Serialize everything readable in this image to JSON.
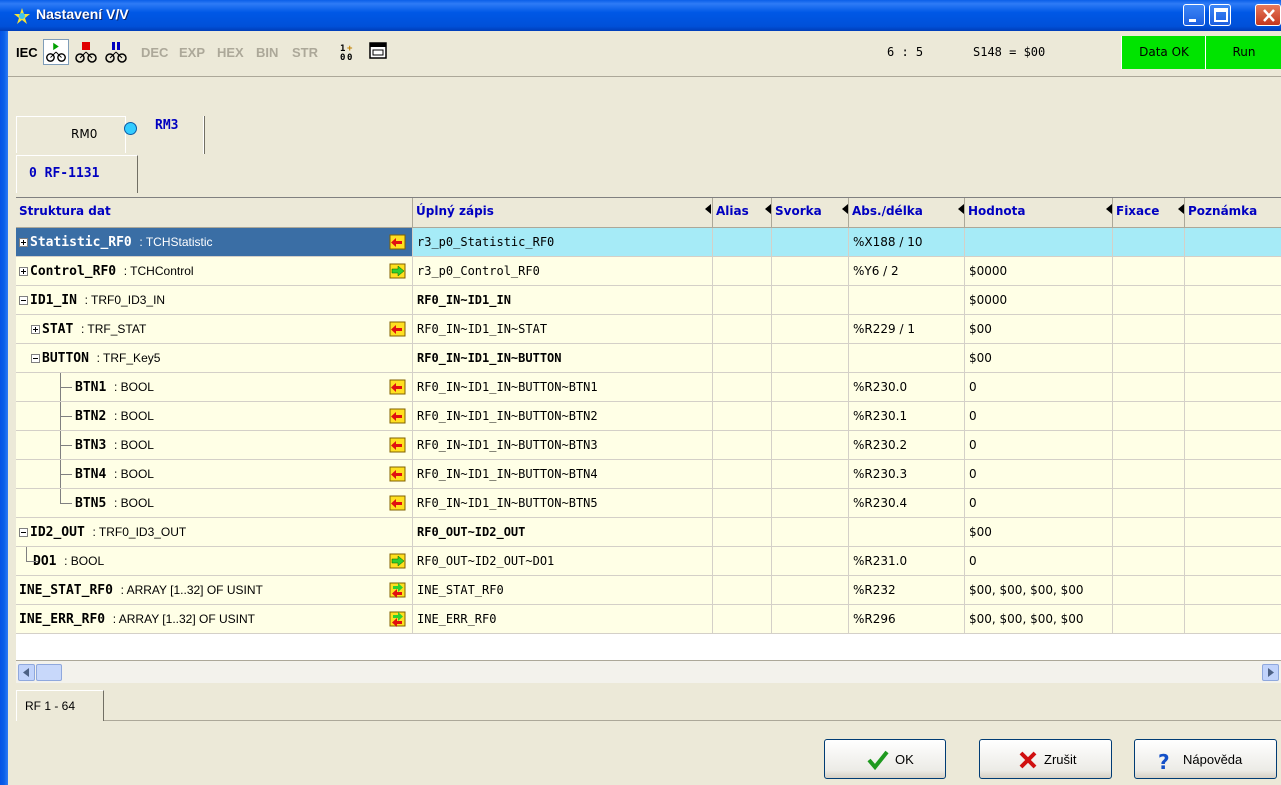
{
  "window": {
    "title": "Nastavení V/V"
  },
  "toolbar": {
    "iec": "IEC",
    "dec": "DEC",
    "exp": "EXP",
    "hex": "HEX",
    "bin": "BIN",
    "str": "STR",
    "position": "6 : 5",
    "status_value": "S148 = $00",
    "data_ok": "Data OK",
    "run": "Run"
  },
  "tabs": {
    "rm0": "RM0",
    "rm3": "RM3",
    "sub": "0 RF-1131",
    "bottom": "RF 1 - 64"
  },
  "columns": [
    "Struktura dat",
    "Úplný zápis",
    "Alias",
    "Svorka",
    "Abs./délka",
    "Hodnota",
    "Fixace",
    "Poznámka"
  ],
  "rows": [
    {
      "name": "Statistic_RF0",
      "type": ": TCHStatistic",
      "full": "r3_p0_Statistic_RF0",
      "abs": "%X188 / 10",
      "value": ""
    },
    {
      "name": "Control_RF0",
      "type": ": TCHControl",
      "full": "r3_p0_Control_RF0",
      "abs": "%Y6 / 2",
      "value": "$0000"
    },
    {
      "name": "ID1_IN",
      "type": ": TRF0_ID3_IN",
      "full": "RF0_IN~ID1_IN",
      "abs": "",
      "value": "$0000"
    },
    {
      "name": "STAT",
      "type": ": TRF_STAT",
      "full": "RF0_IN~ID1_IN~STAT",
      "abs": "%R229 / 1",
      "value": "$00"
    },
    {
      "name": "BUTTON",
      "type": ": TRF_Key5",
      "full": "RF0_IN~ID1_IN~BUTTON",
      "abs": "",
      "value": "$00"
    },
    {
      "name": "BTN1",
      "type": ": BOOL",
      "full": "RF0_IN~ID1_IN~BUTTON~BTN1",
      "abs": "%R230.0",
      "value": "0"
    },
    {
      "name": "BTN2",
      "type": ": BOOL",
      "full": "RF0_IN~ID1_IN~BUTTON~BTN2",
      "abs": "%R230.1",
      "value": "0"
    },
    {
      "name": "BTN3",
      "type": ": BOOL",
      "full": "RF0_IN~ID1_IN~BUTTON~BTN3",
      "abs": "%R230.2",
      "value": "0"
    },
    {
      "name": "BTN4",
      "type": ": BOOL",
      "full": "RF0_IN~ID1_IN~BUTTON~BTN4",
      "abs": "%R230.3",
      "value": "0"
    },
    {
      "name": "BTN5",
      "type": ": BOOL",
      "full": "RF0_IN~ID1_IN~BUTTON~BTN5",
      "abs": "%R230.4",
      "value": "0"
    },
    {
      "name": "ID2_OUT",
      "type": ": TRF0_ID3_OUT",
      "full": "RF0_OUT~ID2_OUT",
      "abs": "",
      "value": "$00"
    },
    {
      "name": "DO1",
      "type": ": BOOL",
      "full": "RF0_OUT~ID2_OUT~DO1",
      "abs": "%R231.0",
      "value": "0"
    },
    {
      "name": "INE_STAT_RF0",
      "type": ": ARRAY [1..32] OF USINT",
      "full": "INE_STAT_RF0",
      "abs": "%R232",
      "value": "$00, $00, $00, $00"
    },
    {
      "name": "INE_ERR_RF0",
      "type": ": ARRAY [1..32] OF USINT",
      "full": "INE_ERR_RF0",
      "abs": "%R296",
      "value": "$00, $00, $00, $00"
    }
  ],
  "buttons": {
    "ok": "OK",
    "cancel": "Zrušit",
    "help": "Nápověda"
  },
  "colors": {
    "titlebar": "#0054E3",
    "ok_green": "#00E400",
    "selected_row": "#A6EBF7",
    "header_text": "#0000C0"
  }
}
